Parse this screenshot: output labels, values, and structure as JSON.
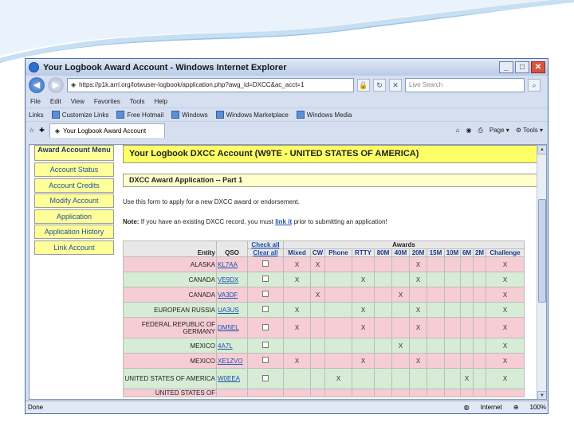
{
  "window": {
    "title": "Your Logbook Award Account - Windows Internet Explorer",
    "address": "https://p1k.arrl.org/lotwuser-logbook/application.php?awg_id=DXCC&ac_acct=1",
    "search_placeholder": "Live Search"
  },
  "menu": [
    "File",
    "Edit",
    "View",
    "Favorites",
    "Tools",
    "Help"
  ],
  "links": [
    "Links",
    "Customize Links",
    "Free Hotmail",
    "Windows",
    "Windows Marketplace",
    "Windows Media"
  ],
  "tab": {
    "label": "Your Logbook Award Account",
    "page_label": "Page",
    "tools_label": "Tools"
  },
  "sidebar": {
    "header": "Award Account Menu",
    "items": [
      "Account Status",
      "Account Credits",
      "Modify Account",
      "Application",
      "Application History",
      "Link Account"
    ]
  },
  "page": {
    "account_title": "Your Logbook DXCC Account (W9TE - UNITED STATES OF AMERICA)",
    "application_title": "DXCC Award Application -- Part 1",
    "instructions": "Use this form to apply for a new DXCC award or endorsement.",
    "note_label": "Note:",
    "note_before": "If you have an existing DXCC record, you must",
    "note_link": "link it",
    "note_after": "prior to submitting an application!"
  },
  "table": {
    "check_all": "Check all",
    "clear_all": "Clear all",
    "awards_group": "Awards",
    "entity_header": "Entity",
    "qso_header": "QSO",
    "award_columns": [
      "Mixed",
      "CW",
      "Phone",
      "RTTY",
      "80M",
      "40M",
      "20M",
      "15M",
      "10M",
      "6M",
      "2M",
      "Challenge"
    ],
    "rows": [
      {
        "entity": "ALASKA",
        "qso": "KL7AA",
        "marks": [
          "X",
          "X",
          "",
          "",
          "",
          "",
          "X",
          "",
          "",
          "",
          "",
          "X"
        ]
      },
      {
        "entity": "CANADA",
        "qso": "VE9DX",
        "marks": [
          "X",
          "",
          "",
          "X",
          "",
          "",
          "X",
          "",
          "",
          "",
          "",
          "X"
        ]
      },
      {
        "entity": "CANADA",
        "qso": "VA3DF",
        "marks": [
          "",
          "X",
          "",
          "",
          "",
          "X",
          "",
          "",
          "",
          "",
          "",
          "X"
        ]
      },
      {
        "entity": "EUROPEAN RUSSIA",
        "qso": "UA3US",
        "marks": [
          "X",
          "",
          "",
          "X",
          "",
          "",
          "X",
          "",
          "",
          "",
          "",
          "X"
        ]
      },
      {
        "entity": "FEDERAL REPUBLIC OF GERMANY",
        "qso": "DM5EL",
        "marks": [
          "X",
          "",
          "",
          "X",
          "",
          "",
          "X",
          "",
          "",
          "",
          "",
          "X"
        ]
      },
      {
        "entity": "MEXICO",
        "qso": "4A7L",
        "marks": [
          "",
          "",
          "",
          "",
          "",
          "X",
          "",
          "",
          "",
          "",
          "",
          "X"
        ]
      },
      {
        "entity": "MEXICO",
        "qso": "XE1ZVO",
        "marks": [
          "X",
          "",
          "",
          "X",
          "",
          "",
          "X",
          "",
          "",
          "",
          "",
          "X"
        ]
      },
      {
        "entity": "UNITED STATES OF AMERICA",
        "qso": "W0EEA",
        "marks": [
          "",
          "",
          "X",
          "",
          "",
          "",
          "",
          "",
          "",
          "X",
          "",
          "X"
        ]
      },
      {
        "entity": "UNITED STATES OF",
        "qso": "",
        "marks": [
          "",
          "",
          "",
          "",
          "",
          "",
          "",
          "",
          "",
          "",
          "",
          ""
        ]
      }
    ]
  },
  "status": {
    "left": "Done",
    "zone": "Internet",
    "zoom": "100%"
  }
}
